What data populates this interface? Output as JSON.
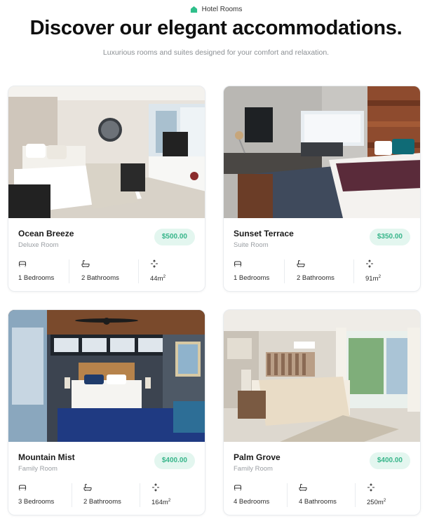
{
  "header": {
    "eyebrow": "Hotel Rooms",
    "title": "Discover our elegant accommodations.",
    "subtitle": "Luxurious rooms and suites designed for your comfort and relaxation."
  },
  "colors": {
    "accent": "#37b58a",
    "price_bg": "#e3f6ef",
    "home_icon": "#2fbf8b"
  },
  "icons": {
    "eyebrow": "home-icon",
    "bedrooms": "bed-icon",
    "bathrooms": "bathtub-icon",
    "area": "area-icon"
  },
  "rooms": [
    {
      "name": "Ocean Breeze",
      "type": "Deluxe Room",
      "price": "$500.00",
      "bedrooms": "1 Bedrooms",
      "bathrooms": "2 Bathrooms",
      "area": "44m",
      "area_unit": "2"
    },
    {
      "name": "Sunset Terrace",
      "type": "Suite Room",
      "price": "$350.00",
      "bedrooms": "1 Bedrooms",
      "bathrooms": "2 Bathrooms",
      "area": "91m",
      "area_unit": "2"
    },
    {
      "name": "Mountain Mist",
      "type": "Family Room",
      "price": "$400.00",
      "bedrooms": "3 Bedrooms",
      "bathrooms": "2 Bathrooms",
      "area": "164m",
      "area_unit": "2"
    },
    {
      "name": "Palm Grove",
      "type": "Family Room",
      "price": "$400.00",
      "bedrooms": "4 Bedrooms",
      "bathrooms": "4 Bathrooms",
      "area": "250m",
      "area_unit": "2"
    }
  ]
}
